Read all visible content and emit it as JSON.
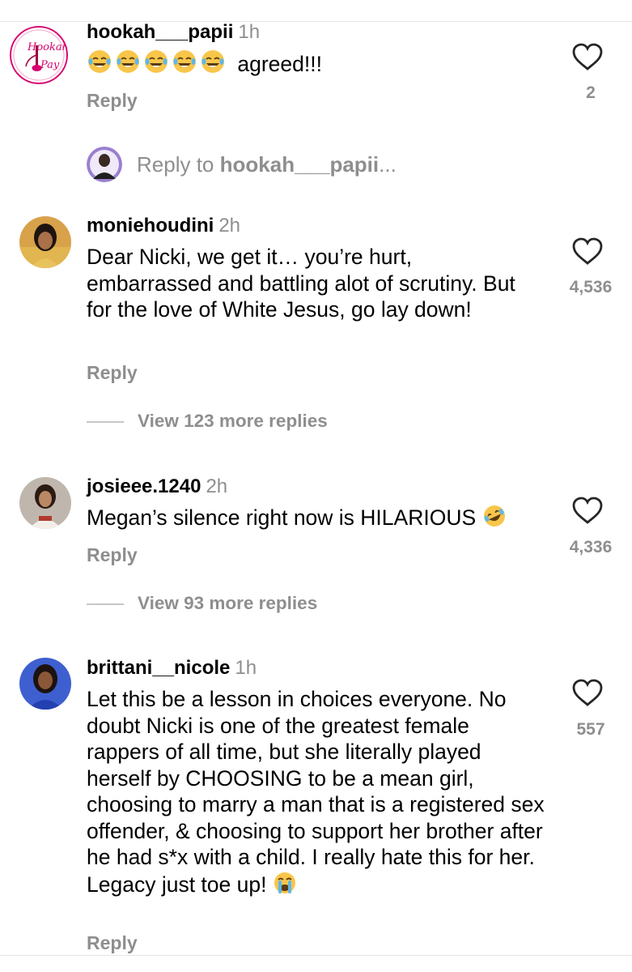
{
  "comments": [
    {
      "username": "hookah___papii",
      "time": "1h",
      "text": "agreed!!!",
      "emoji_prefix": [
        "joy-emoji",
        "joy-emoji",
        "joy-emoji",
        "joy-emoji",
        "joy-emoji"
      ],
      "likes": "2",
      "reply_label": "Reply",
      "avatar": "hookah-pay-logo"
    },
    {
      "username": "moniehoudini",
      "time": "2h",
      "text": "Dear Nicki, we get it… you’re hurt, embarrassed and battling alot of scrutiny. But for the love of White Jesus, go lay down!",
      "likes": "4,536",
      "reply_label": "Reply",
      "view_replies": "View 123 more replies"
    },
    {
      "username": "josieee.1240",
      "time": "2h",
      "text": "Megan’s silence right now is HILARIOUS",
      "emoji_suffix": "rofl-emoji",
      "likes": "4,336",
      "reply_label": "Reply",
      "view_replies": "View 93 more replies"
    },
    {
      "username": "brittani__nicole",
      "time": "1h",
      "text": "Let this be a lesson in choices everyone. No doubt Nicki is one of the greatest female rappers of all time, but she literally played herself by CHOOSING to be a mean girl, choosing to marry a man that is a registered sex offender, & choosing to support her brother after he had s*x with a child. I really hate this for her. Legacy just toe up!",
      "emoji_suffix": "loudly-crying-emoji",
      "likes": "557",
      "reply_label": "Reply"
    }
  ],
  "reply_to": {
    "prefix": "Reply to",
    "username": "hookah___papii",
    "suffix": "..."
  },
  "logo_text": "Hookah Pay",
  "colors": {
    "secondary_text": "#8e8e8e",
    "logo_pink": "#d7006f",
    "emoji_yellow": "#f8c64a"
  }
}
